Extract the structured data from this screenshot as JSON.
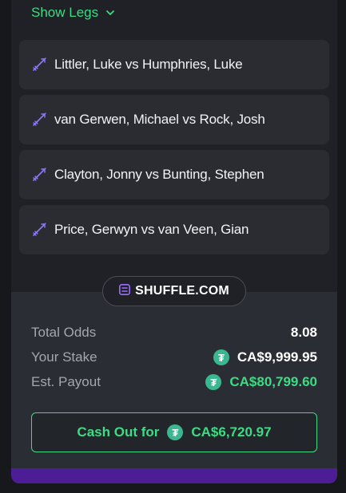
{
  "show_legs": {
    "label": "Show Legs",
    "icon": "chevron-down-icon"
  },
  "legs": [
    {
      "label": "Littler, Luke vs Humphries, Luke",
      "icon": "dart-icon"
    },
    {
      "label": "van Gerwen, Michael vs Rock, Josh",
      "icon": "dart-icon"
    },
    {
      "label": "Clayton, Jonny vs Bunting, Stephen",
      "icon": "dart-icon"
    },
    {
      "label": "Price, Gerwyn vs van Veen, Gian",
      "icon": "dart-icon"
    }
  ],
  "brand": {
    "text": "SHUFFLE.COM",
    "icon": "shuffle-logo-icon"
  },
  "summary": {
    "total_odds_label": "Total Odds",
    "total_odds_value": "8.08",
    "your_stake_label": "Your Stake",
    "your_stake_value": "CA$9,999.95",
    "est_payout_label": "Est. Payout",
    "est_payout_value": "CA$80,799.60",
    "currency_icon": "tether-icon",
    "currency_symbol": "₮"
  },
  "cashout": {
    "label": "Cash Out for",
    "value": "CA$6,720.97"
  },
  "colors": {
    "accent_green": "#3ddc84",
    "leg_icon_purple": "#8b7cf6",
    "coin_teal": "#3bb78f",
    "bottom_bar_purple": "#4c1d95"
  }
}
